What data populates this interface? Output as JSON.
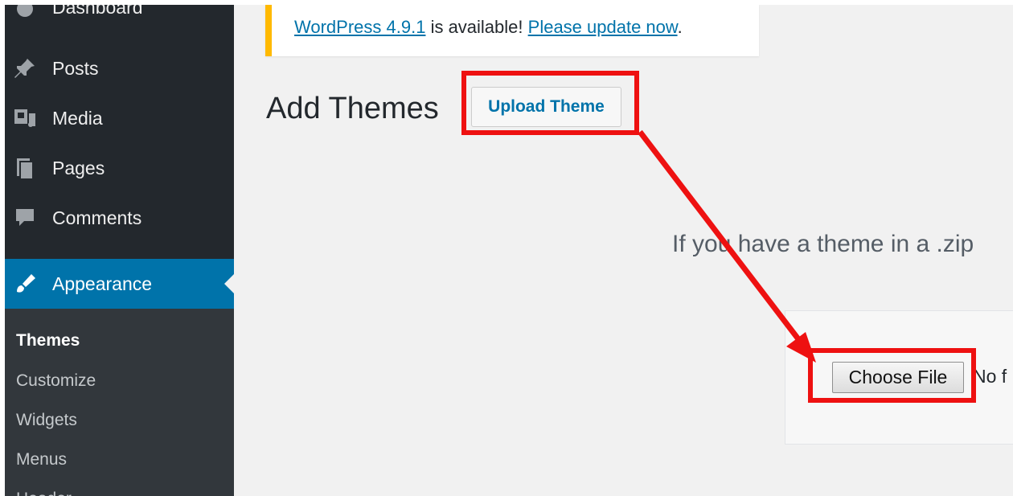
{
  "sidebar": {
    "top_item": "Dashboard",
    "items": [
      {
        "label": "Posts",
        "icon": "pin-icon"
      },
      {
        "label": "Media",
        "icon": "media-icon"
      },
      {
        "label": "Pages",
        "icon": "pages-icon"
      },
      {
        "label": "Comments",
        "icon": "comment-icon"
      },
      {
        "label": "Appearance",
        "icon": "paintbrush-icon"
      }
    ],
    "submenu": [
      "Themes",
      "Customize",
      "Widgets",
      "Menus",
      "Header"
    ]
  },
  "notice": {
    "version_link": "WordPress 4.9.1",
    "middle_text": " is available! ",
    "update_link": "Please update now",
    "end": "."
  },
  "page": {
    "title": "Add Themes",
    "upload_button": "Upload Theme",
    "help_text": "If you have a theme in a .zip",
    "choose_button": "Choose File",
    "no_file_text": "No f"
  },
  "colors": {
    "sidebar_bg": "#23282d",
    "active_bg": "#0073aa",
    "link": "#0073aa",
    "highlight": "#ee1111",
    "notice_border": "#ffb900"
  }
}
